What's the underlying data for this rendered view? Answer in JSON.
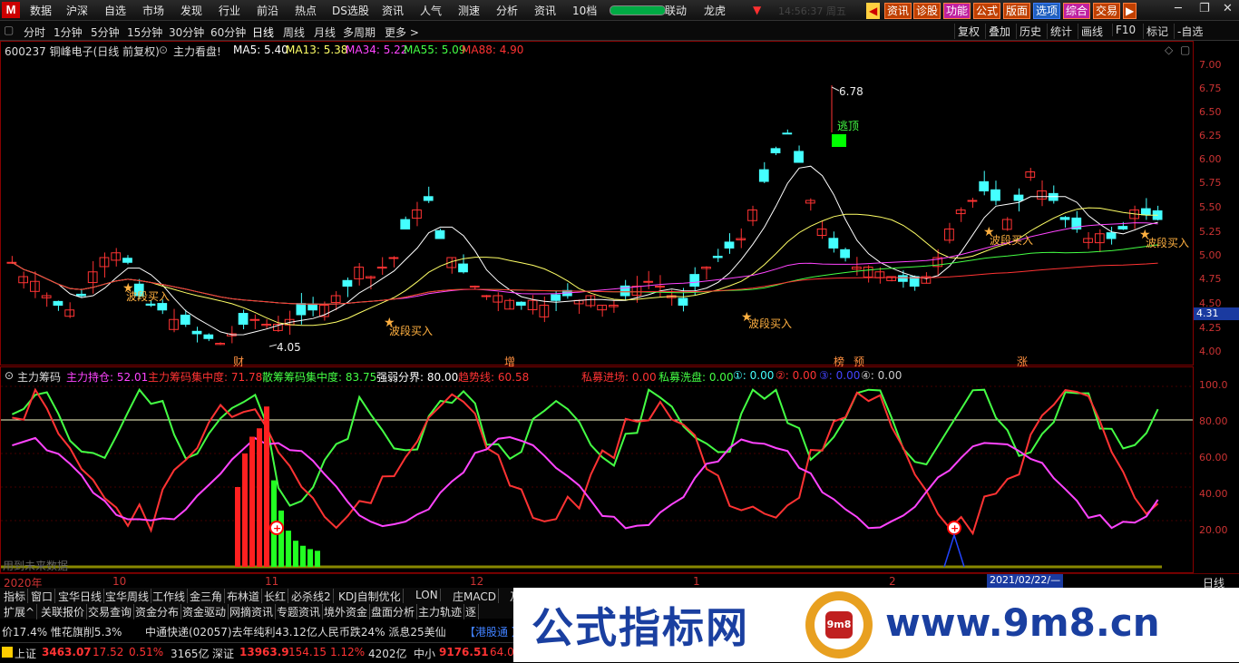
{
  "menu": {
    "logo": "M",
    "items": [
      "数据",
      "沪深",
      "自选",
      "市场",
      "发现",
      "行业",
      "前沿",
      "热点",
      "DS选股",
      "资讯",
      "人气",
      "测速",
      "分析",
      "资讯",
      "10档",
      "联动",
      "龙虎"
    ],
    "clock": "14:56:37 周五",
    "tools": [
      "资讯",
      "诊股",
      "功能",
      "公式",
      "版面",
      "选项",
      "综合",
      "交易"
    ],
    "window": [
      "─",
      "❐",
      "✕"
    ]
  },
  "periods": {
    "items": [
      "分时",
      "1分钟",
      "5分钟",
      "15分钟",
      "30分钟",
      "60分钟",
      "日线",
      "周线",
      "月线",
      "多周期",
      "更多 >"
    ],
    "active": "日线",
    "right": [
      "复权",
      "叠加",
      "历史",
      "统计",
      "画线",
      "F10",
      "标记",
      "-自选"
    ]
  },
  "stock": {
    "title": "600237 铜峰电子(日线 前复权)",
    "indicator_name": "主力看盘!",
    "ma": [
      {
        "label": "MA5: 5.40",
        "color": "#ffffff"
      },
      {
        "label": "MA13: 5.38",
        "color": "#ffff66"
      },
      {
        "label": "MA34: 5.22",
        "color": "#ff44ff"
      },
      {
        "label": "MA55: 5.09",
        "color": "#44ff44"
      },
      {
        "label": "MA88: 4.90",
        "color": "#ff3333"
      }
    ],
    "high_label": "6.78",
    "low_label": "4.05",
    "escape_label": "逃顶",
    "buy_label": "波段买入",
    "current_price": "4.31",
    "events": [
      "财",
      "增",
      "榜",
      "预",
      "涨"
    ]
  },
  "main_axis": [
    "7.00",
    "6.75",
    "6.50",
    "6.25",
    "6.00",
    "5.75",
    "5.50",
    "5.25",
    "5.00",
    "4.75",
    "4.50",
    "4.25",
    "4.00"
  ],
  "sub": {
    "name": "主力筹码",
    "items": [
      {
        "label": "主力持仓: 52.01",
        "color": "#ff44ff"
      },
      {
        "label": "主力筹码集中度: 71.78",
        "color": "#ff3333"
      },
      {
        "label": "散筹筹码集中度: 83.75",
        "color": "#44ff44"
      },
      {
        "label": "强弱分界: 80.00",
        "color": "#ffffff"
      },
      {
        "label": "趋势线: 60.58",
        "color": "#ff3333"
      },
      {
        "label": "私募进场: 0.00",
        "color": "#ff3333"
      },
      {
        "label": "私募洗盘: 0.00",
        "color": "#44ff44"
      },
      {
        "label": "①: 0.00",
        "color": "#44ffff"
      },
      {
        "label": "②: 0.00",
        "color": "#ff3333"
      },
      {
        "label": "③: 0.00",
        "color": "#4444ff"
      },
      {
        "label": "④: 0.00",
        "color": "#cccccc"
      }
    ],
    "axis": [
      "100.0",
      "80.00",
      "60.00",
      "40.00",
      "20.00"
    ],
    "footnote": "用到未来数据"
  },
  "dates": {
    "labels": [
      "2020年",
      "10",
      "11",
      "12",
      "1",
      "2"
    ],
    "cursor": "2021/02/22/—",
    "period": "日线"
  },
  "tabs1": [
    "指标",
    "窗口",
    "宝华日线",
    "宝华周线",
    "工作线",
    "金三角",
    "布林道",
    "长红",
    "必杀线2",
    "KDJ自制优化",
    "LON",
    "庄MACD",
    "及"
  ],
  "tabs2": [
    "扩展^",
    "关联报价",
    "交易查询",
    "资金分布",
    "资金驱动",
    "网摘资讯",
    "专题资讯",
    "境外资金",
    "盘面分析",
    "主力轨迹",
    "逐"
  ],
  "ticker": {
    "left": "价17.4%  惟花旗削5.3%",
    "news": "中通快递(02057)去年纯利43.12亿人民币跌24% 派息25美仙",
    "tag": "【港股通 】"
  },
  "status": {
    "sh_name": "上证",
    "sh_value": "3463.07",
    "sh_change": "17.52",
    "sh_pct": "0.51%",
    "sh_amount": "3165亿",
    "sz_name": "深证",
    "sz_value": "13963.9",
    "sz_change": "154.15",
    "sz_pct": "1.12%",
    "sz_amount": "4202亿",
    "zx_name": "中小",
    "zx_value": "9176.51",
    "zx_change": "64.0"
  },
  "banner": {
    "title": "公式指标网",
    "url": "www.9m8.cn",
    "logo_text": "9m8"
  },
  "colors": {
    "up": "#ff3333",
    "down": "#44ffff",
    "accent": "#ff8040"
  }
}
